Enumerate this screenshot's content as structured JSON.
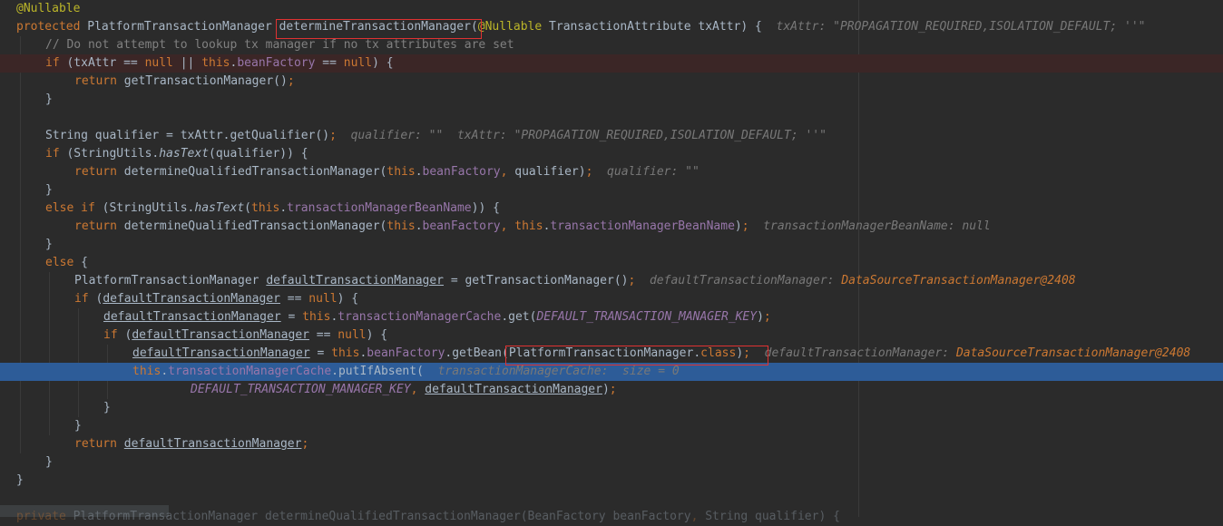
{
  "editor": {
    "colors": {
      "background": "#2b2b2b",
      "current_execution_line": "#2d5c98",
      "breakpoint_line": "#3b2626",
      "highlight_box": "#e03232"
    },
    "lines": [
      [
        [
          "ann",
          "@Nullable"
        ]
      ],
      [
        [
          "kw",
          "protected "
        ],
        [
          "pl",
          "PlatformTransactionManager "
        ],
        [
          "pl",
          "determineTransactionManager"
        ],
        [
          "pl",
          "("
        ],
        [
          "ann",
          "@Nullable "
        ],
        [
          "pl",
          "TransactionAttribute txAttr) {  "
        ],
        [
          "hint",
          "txAttr: \"PROPAGATION_REQUIRED,ISOLATION_DEFAULT; ''\""
        ]
      ],
      [
        [
          "cm",
          "// Do not attempt to lookup tx manager if no tx attributes are set"
        ]
      ],
      [
        [
          "kw",
          "if "
        ],
        [
          "pl",
          "(txAttr == "
        ],
        [
          "kw",
          "null "
        ],
        [
          "pl",
          "|| "
        ],
        [
          "kw",
          "this"
        ],
        [
          "pl",
          "."
        ],
        [
          "fld",
          "beanFactory "
        ],
        [
          "pl",
          "== "
        ],
        [
          "kw",
          "null"
        ],
        [
          "pl",
          ") {"
        ]
      ],
      [
        [
          "kw",
          "return "
        ],
        [
          "pl",
          "getTransactionManager()"
        ],
        [
          "kw",
          ";"
        ]
      ],
      [
        [
          "pl",
          "}"
        ]
      ],
      [],
      [
        [
          "pl",
          "String qualifier = txAttr.getQualifier()"
        ],
        [
          "kw",
          ";  "
        ],
        [
          "hint",
          "qualifier: \"\"  txAttr: \"PROPAGATION_REQUIRED,ISOLATION_DEFAULT; ''\""
        ]
      ],
      [
        [
          "kw",
          "if "
        ],
        [
          "pl",
          "(StringUtils."
        ],
        [
          "st",
          "hasText"
        ],
        [
          "pl",
          "(qualifier)) {"
        ]
      ],
      [
        [
          "kw",
          "return "
        ],
        [
          "pl",
          "determineQualifiedTransactionManager("
        ],
        [
          "kw",
          "this"
        ],
        [
          "pl",
          "."
        ],
        [
          "fld",
          "beanFactory"
        ],
        [
          "kw",
          ", "
        ],
        [
          "pl",
          "qualifier)"
        ],
        [
          "kw",
          ";  "
        ],
        [
          "hint",
          "qualifier: \"\""
        ]
      ],
      [
        [
          "pl",
          "}"
        ]
      ],
      [
        [
          "kw",
          "else if "
        ],
        [
          "pl",
          "(StringUtils."
        ],
        [
          "st",
          "hasText"
        ],
        [
          "pl",
          "("
        ],
        [
          "kw",
          "this"
        ],
        [
          "pl",
          "."
        ],
        [
          "fld",
          "transactionManagerBeanName"
        ],
        [
          "pl",
          ")) {"
        ]
      ],
      [
        [
          "kw",
          "return "
        ],
        [
          "pl",
          "determineQualifiedTransactionManager("
        ],
        [
          "kw",
          "this"
        ],
        [
          "pl",
          "."
        ],
        [
          "fld",
          "beanFactory"
        ],
        [
          "kw",
          ", this"
        ],
        [
          "pl",
          "."
        ],
        [
          "fld",
          "transactionManagerBeanName"
        ],
        [
          "pl",
          ")"
        ],
        [
          "kw",
          ";  "
        ],
        [
          "hint",
          "transactionManagerBeanName: null"
        ]
      ],
      [
        [
          "pl",
          "}"
        ]
      ],
      [
        [
          "kw",
          "else "
        ],
        [
          "pl",
          "{"
        ]
      ],
      [
        [
          "pl",
          "PlatformTransactionManager "
        ],
        [
          "ul",
          "defaultTransactionManager"
        ],
        [
          "pl",
          " = getTransactionManager()"
        ],
        [
          "kw",
          ";  "
        ],
        [
          "hint",
          "defaultTransactionManager: "
        ],
        [
          "hintv",
          "DataSourceTransactionManager@2408"
        ]
      ],
      [
        [
          "kw",
          "if "
        ],
        [
          "pl",
          "("
        ],
        [
          "ul",
          "defaultTransactionManager"
        ],
        [
          "pl",
          " == "
        ],
        [
          "kw",
          "null"
        ],
        [
          "pl",
          ") {"
        ]
      ],
      [
        [
          "ul",
          "defaultTransactionManager"
        ],
        [
          "pl",
          " = "
        ],
        [
          "kw",
          "this"
        ],
        [
          "pl",
          "."
        ],
        [
          "fld",
          "transactionManagerCache"
        ],
        [
          "pl",
          ".get("
        ],
        [
          "cst",
          "DEFAULT_TRANSACTION_MANAGER_KEY"
        ],
        [
          "pl",
          ")"
        ],
        [
          "kw",
          ";"
        ]
      ],
      [
        [
          "kw",
          "if "
        ],
        [
          "pl",
          "("
        ],
        [
          "ul",
          "defaultTransactionManager"
        ],
        [
          "pl",
          " == "
        ],
        [
          "kw",
          "null"
        ],
        [
          "pl",
          ") {"
        ]
      ],
      [
        [
          "ul",
          "defaultTransactionManager"
        ],
        [
          "pl",
          " = "
        ],
        [
          "kw",
          "this"
        ],
        [
          "pl",
          "."
        ],
        [
          "fld",
          "beanFactory"
        ],
        [
          "pl",
          ".getBean("
        ],
        [
          "pl",
          "PlatformTransactionManager."
        ],
        [
          "kw",
          "class"
        ],
        [
          "pl",
          ")"
        ],
        [
          "kw",
          ";  "
        ],
        [
          "hint",
          "defaultTransactionManager: "
        ],
        [
          "hintv",
          "DataSourceTransactionManager@2408"
        ]
      ],
      [
        [
          "kw",
          "this"
        ],
        [
          "pl",
          "."
        ],
        [
          "fld",
          "transactionManagerCache"
        ],
        [
          "pl",
          ".putIfAbsent(  "
        ],
        [
          "hint",
          "transactionManagerCache:  size = 0"
        ]
      ],
      [
        [
          "cst",
          "DEFAULT_TRANSACTION_MANAGER_KEY"
        ],
        [
          "kw",
          ", "
        ],
        [
          "ul",
          "defaultTransactionManager"
        ],
        [
          "pl",
          ")"
        ],
        [
          "kw",
          ";"
        ]
      ],
      [
        [
          "pl",
          "}"
        ]
      ],
      [
        [
          "pl",
          "}"
        ]
      ],
      [
        [
          "kw",
          "return "
        ],
        [
          "ul",
          "defaultTransactionManager"
        ],
        [
          "kw",
          ";"
        ]
      ],
      [
        [
          "pl",
          "}"
        ]
      ],
      [
        [
          "pl",
          "}"
        ]
      ],
      [],
      [
        [
          "kw",
          "private "
        ],
        [
          "pl",
          "PlatformTransactionManager "
        ],
        [
          "pl",
          "determineQualifiedTransactionManager"
        ],
        [
          "pl",
          "(BeanFactory beanFactory"
        ],
        [
          "kw",
          ", "
        ],
        [
          "pl",
          "String qualifier) {"
        ]
      ]
    ]
  }
}
